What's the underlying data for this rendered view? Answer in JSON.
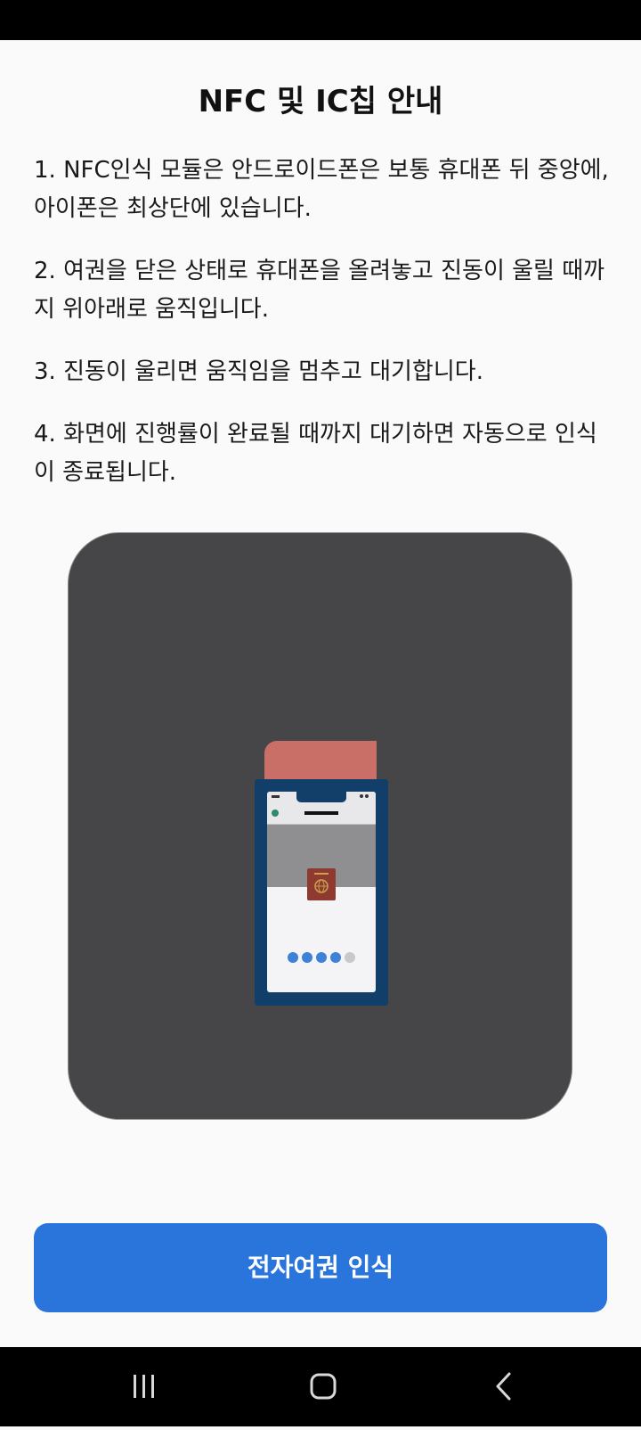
{
  "page": {
    "title": "NFC 및 IC칩 안내"
  },
  "guide": {
    "items": [
      "1. NFC인식 모듈은 안드로이드폰은 보통 휴대폰 뒤 중앙에, 아이폰은 최상단에 있습니다.",
      "2. 여권을 닫은 상태로 휴대폰을 올려놓고 진동이 울릴 때까지 위아래로 움직입니다.",
      "3. 진동이 울리면 움직임을 멈추고 대기합니다.",
      "4. 화면에 진행률이 완료될 때까지 대기하면 자동으로 인식이 종료됩니다."
    ]
  },
  "illustration": {
    "icons": [
      "phone-icon",
      "passport-icon",
      "globe-icon"
    ],
    "progress_dots_active": 4,
    "progress_dots_total": 5
  },
  "primary_button": {
    "label": "전자여권 인식"
  },
  "nav_bar": {
    "icons": [
      "recent-apps-icon",
      "home-icon",
      "back-icon"
    ]
  },
  "colors": {
    "accent": "#2a75dc",
    "phone_frame": "#123f69",
    "passport": "#c96f67",
    "illustration_bg": "#464648",
    "dot_active": "#3b82d8",
    "dot_inactive": "#c8c8c8"
  }
}
